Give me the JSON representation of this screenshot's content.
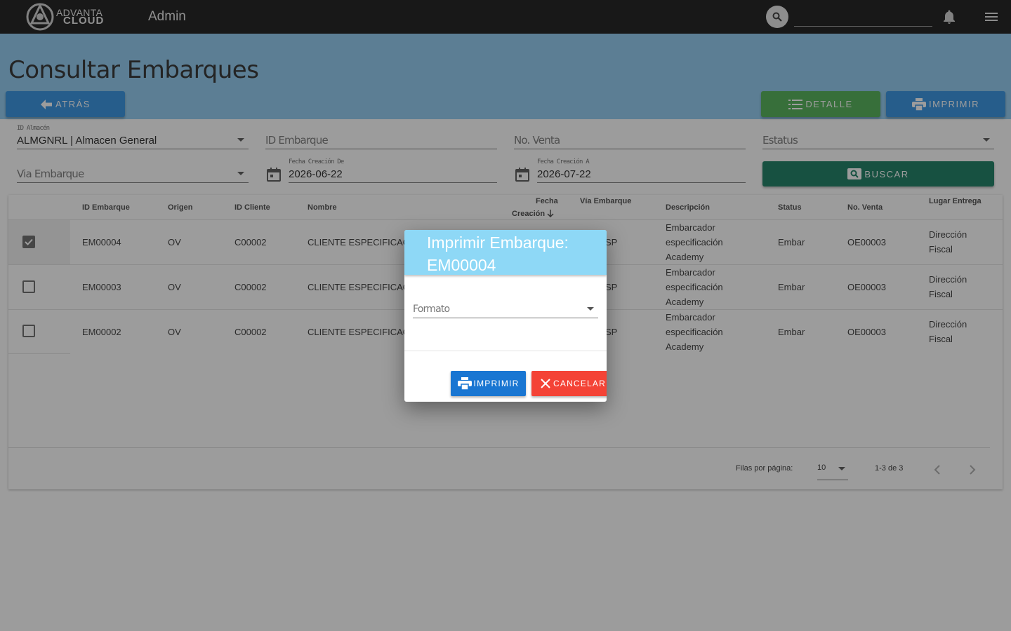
{
  "topbar": {
    "logo_line1": "ADVANTA",
    "logo_line2": "CLOUD",
    "app_title": "Admin",
    "search_value": ""
  },
  "page": {
    "title": "Consultar Embarques",
    "back_label": "ATRÁS",
    "detalle_label": "DETALLE",
    "imprimir_label": "IMPRIMIR",
    "buscar_label": "BUSCAR"
  },
  "filters": {
    "almacen_label": "ID Almacén",
    "almacen_value": "ALMGNRL | Almacen General",
    "embarque_placeholder": "ID Embarque",
    "venta_placeholder": "No. Venta",
    "estatus_placeholder": "Estatus",
    "via_placeholder": "Via Embarque",
    "fecha_de_label": "Fecha Creación De",
    "fecha_de_value": "2026-06-22",
    "fecha_a_label": "Fecha Creación A",
    "fecha_a_value": "2026-07-22"
  },
  "table": {
    "headers": {
      "id_embarque": "ID Embarque",
      "origen": "Origen",
      "id_cliente": "ID Cliente",
      "nombre": "Nombre",
      "fecha_line1": "Fecha",
      "fecha_line2": "Creación",
      "via": "Vía Embarque",
      "descripcion": "Descripción",
      "status": "Status",
      "no_venta": "No. Venta",
      "lugar": "Lugar Entrega"
    },
    "rows": [
      {
        "id": "EM00004",
        "origen": "OV",
        "cliente": "C00002",
        "nombre": "CLIENTE ESPECIFICACIO",
        "via": "SP",
        "desc1": "Embarcador",
        "desc2": "especificación",
        "desc3": "Academy",
        "status": "Embar",
        "venta": "OE00003",
        "lugar1": "Dirección",
        "lugar2": "Fiscal"
      },
      {
        "id": "EM00003",
        "origen": "OV",
        "cliente": "C00002",
        "nombre": "CLIENTE ESPECIFICACIO",
        "via": "SP",
        "desc1": "Embarcador",
        "desc2": "especificación",
        "desc3": "Academy",
        "status": "Embar",
        "venta": "OE00003",
        "lugar1": "Dirección",
        "lugar2": "Fiscal"
      },
      {
        "id": "EM00002",
        "origen": "OV",
        "cliente": "C00002",
        "nombre": "CLIENTE ESPECIFICACIO",
        "via": "SP",
        "desc1": "Embarcador",
        "desc2": "especificación",
        "desc3": "Academy",
        "status": "Embar",
        "venta": "OE00003",
        "lugar1": "Dirección",
        "lugar2": "Fiscal"
      }
    ],
    "pagination": {
      "rows_label": "Filas por página:",
      "rows_value": "10",
      "range": "1-3 de 3"
    }
  },
  "dialog": {
    "title": "Imprimir Embarque: EM00004",
    "formato_placeholder": "Formato",
    "print_label": "IMPRIMIR",
    "cancel_label": "CANCELAR"
  },
  "colors": {
    "topbar": "#151515",
    "hero": "#8ecaf0",
    "primary": "#2d8fe0",
    "success": "#4caf50",
    "buscar": "#137a5e",
    "dialog_header": "#8ed8f6",
    "danger": "#f44336"
  }
}
